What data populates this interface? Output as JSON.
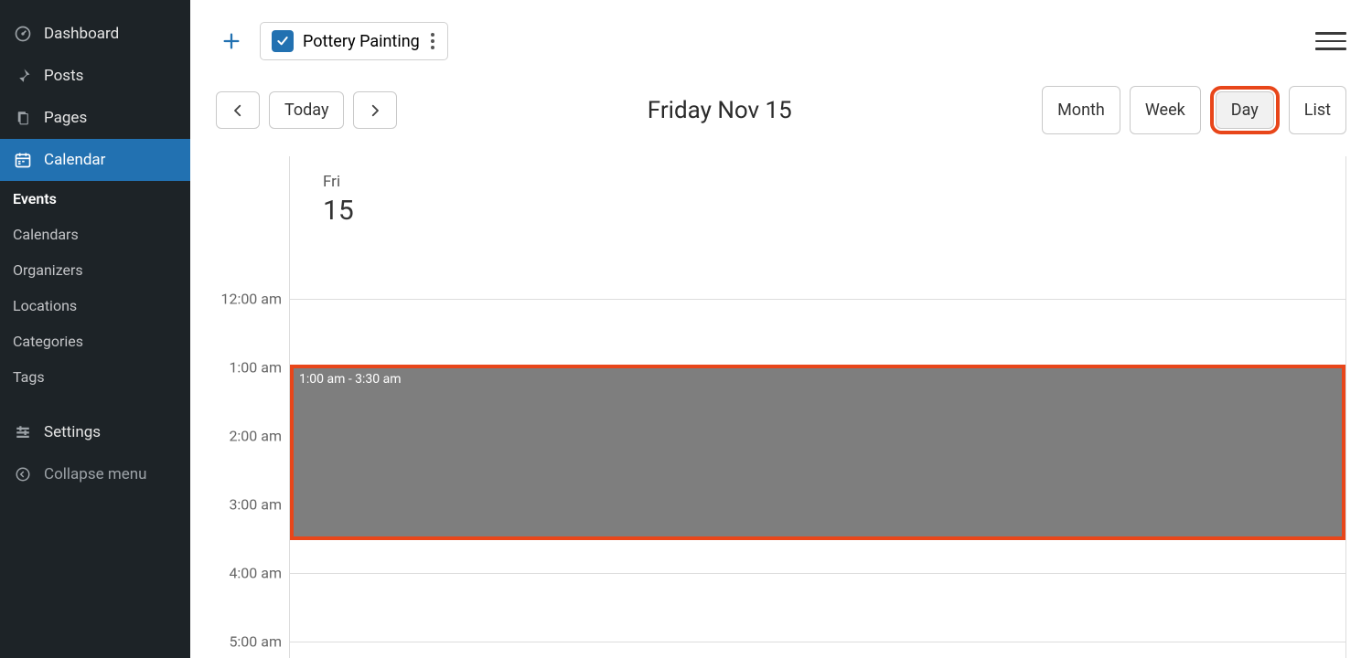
{
  "sidebar": {
    "items": [
      {
        "label": "Dashboard"
      },
      {
        "label": "Posts"
      },
      {
        "label": "Pages"
      },
      {
        "label": "Calendar"
      },
      {
        "label": "Settings"
      },
      {
        "label": "Collapse menu"
      }
    ],
    "submenu": [
      {
        "label": "Events"
      },
      {
        "label": "Calendars"
      },
      {
        "label": "Organizers"
      },
      {
        "label": "Locations"
      },
      {
        "label": "Categories"
      },
      {
        "label": "Tags"
      }
    ]
  },
  "cal_chip": {
    "name": "Pottery Painting"
  },
  "nav": {
    "today": "Today",
    "title": "Friday Nov 15",
    "views": {
      "month": "Month",
      "week": "Week",
      "day": "Day",
      "list": "List"
    }
  },
  "day_header": {
    "dow": "Fri",
    "num": "15"
  },
  "hours": [
    "12:00 am",
    "1:00 am",
    "2:00 am",
    "3:00 am",
    "4:00 am",
    "5:00 am"
  ],
  "selection": {
    "label": "1:00 am - 3:30 am"
  }
}
